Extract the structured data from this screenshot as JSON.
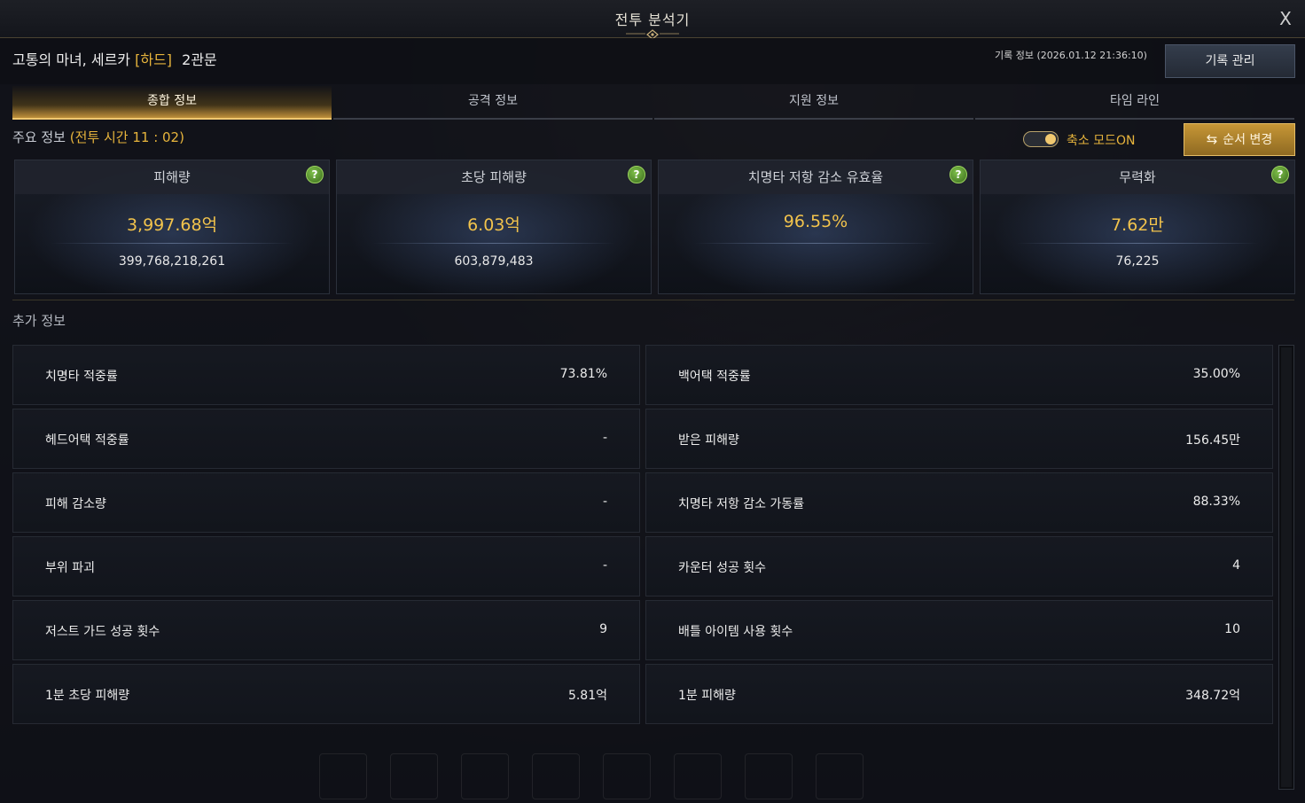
{
  "window": {
    "title": "전투 분석기",
    "close_label": "X"
  },
  "header": {
    "raid_name": "고통의 마녀, 세르카",
    "difficulty": "[하드]",
    "gate": "2관문",
    "record_info": "기록 정보 (2026.01.12 21:36:10)",
    "record_button": "기록 관리"
  },
  "tabs": [
    {
      "label": "종합 정보",
      "active": true
    },
    {
      "label": "공격 정보",
      "active": false
    },
    {
      "label": "지원 정보",
      "active": false
    },
    {
      "label": "타임 라인",
      "active": false
    }
  ],
  "main_info": {
    "label": "주요 정보",
    "battle_time": "(전투 시간 11 : 02)",
    "toggle_label": "축소 모드ON",
    "toggle_on": true,
    "order_button": "순서 변경"
  },
  "cards": [
    {
      "title": "피해량",
      "value": "3,997.68억",
      "sub": "399,768,218,261"
    },
    {
      "title": "초당 피해량",
      "value": "6.03억",
      "sub": "603,879,483"
    },
    {
      "title": "치명타 저항 감소 유효율",
      "value": "96.55%",
      "sub": ""
    },
    {
      "title": "무력화",
      "value": "7.62만",
      "sub": "76,225"
    }
  ],
  "help_label": "?",
  "extra": {
    "title": "추가 정보",
    "rows": [
      {
        "left_label": "치명타 적중률",
        "left_value": "73.81%",
        "right_label": "백어택 적중률",
        "right_value": "35.00%"
      },
      {
        "left_label": "헤드어택 적중률",
        "left_value": "-",
        "right_label": "받은 피해량",
        "right_value": "156.45만"
      },
      {
        "left_label": "피해 감소량",
        "left_value": "-",
        "right_label": "치명타 저항 감소 가동률",
        "right_value": "88.33%"
      },
      {
        "left_label": "부위 파괴",
        "left_value": "-",
        "right_label": "카운터 성공 횟수",
        "right_value": "4"
      },
      {
        "left_label": "저스트 가드 성공 횟수",
        "left_value": "9",
        "right_label": "배틀 아이템 사용 횟수",
        "right_value": "10"
      },
      {
        "left_label": "1분 초당 피해량",
        "left_value": "5.81억",
        "right_label": "1분 피해량",
        "right_value": "348.72억"
      }
    ]
  },
  "colors": {
    "accent_gold": "#e7b43c",
    "value_gold": "#f2c34c",
    "help_green": "#5aa02c"
  }
}
